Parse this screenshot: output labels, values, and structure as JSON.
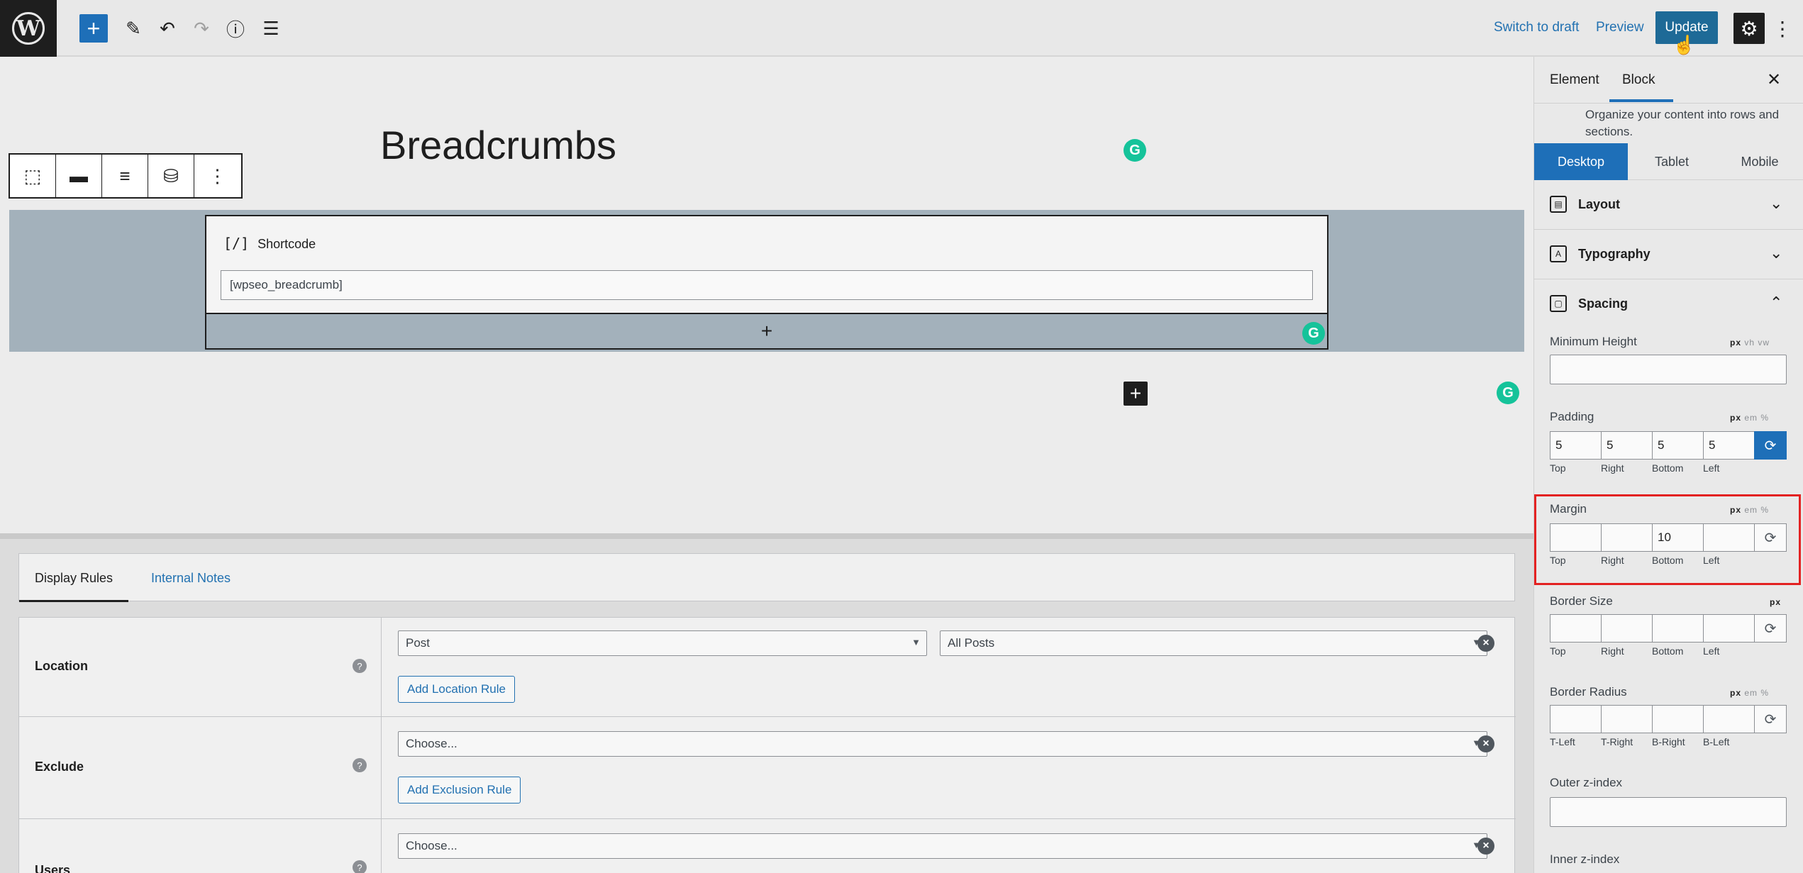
{
  "topbar": {
    "switch_to_draft": "Switch to draft",
    "preview": "Preview",
    "update": "Update",
    "icons": [
      "add-block-icon",
      "pencil-icon",
      "undo-icon",
      "redo-icon",
      "info-icon",
      "list-view-icon",
      "gear-icon",
      "more-vertical-icon"
    ]
  },
  "canvas": {
    "title": "Breadcrumbs",
    "shortcode_label": "Shortcode",
    "shortcode_icon": "[/]",
    "shortcode_value": "[wpseo_breadcrumb]"
  },
  "meta": {
    "tabs": [
      "Display Rules",
      "Internal Notes"
    ],
    "rules": [
      {
        "label": "Location",
        "select1": "Post",
        "select2": "All Posts",
        "button": "Add Location Rule"
      },
      {
        "label": "Exclude",
        "select1": "Choose...",
        "button": "Add Exclusion Rule"
      },
      {
        "label": "Users",
        "select1": "Choose..."
      }
    ]
  },
  "sidebar": {
    "tabs": [
      "Element",
      "Block"
    ],
    "description": "Organize your content into rows and sections.",
    "devices": [
      "Desktop",
      "Tablet",
      "Mobile"
    ],
    "panels": [
      "Layout",
      "Typography",
      "Spacing"
    ],
    "min_height_label": "Minimum Height",
    "padding": {
      "label": "Padding",
      "values": [
        "5",
        "5",
        "5",
        "5"
      ],
      "labels": [
        "Top",
        "Right",
        "Bottom",
        "Left"
      ]
    },
    "margin": {
      "label": "Margin",
      "values": [
        "",
        "",
        "10",
        ""
      ],
      "labels": [
        "Top",
        "Right",
        "Bottom",
        "Left"
      ]
    },
    "border_size": {
      "label": "Border Size",
      "labels": [
        "Top",
        "Right",
        "Bottom",
        "Left"
      ]
    },
    "border_radius": {
      "label": "Border Radius",
      "labels": [
        "T-Left",
        "T-Right",
        "B-Right",
        "B-Left"
      ]
    },
    "outer_z": "Outer z-index",
    "inner_z": "Inner z-index",
    "units": {
      "px": "px",
      "vh": "vh",
      "vw": "vw",
      "em": "em",
      "pct": "%"
    }
  },
  "colors": {
    "accent": "#1e6fb8",
    "highlight": "#e32222",
    "grammarly": "#15c39a"
  }
}
